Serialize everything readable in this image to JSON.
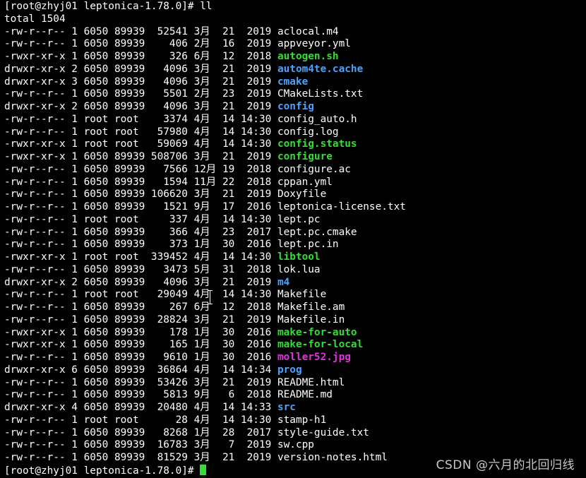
{
  "terminal": {
    "command_line": "[root@zhyj01 leptonica-1.78.0]# ll",
    "total_line": "total 1504",
    "entries": [
      {
        "meta": "-rw-r--r-- 1 6050 89939  52541 3月  21  2019 ",
        "name": "aclocal.m4",
        "type": "plain"
      },
      {
        "meta": "-rw-r--r-- 1 6050 89939    406 2月  16  2019 ",
        "name": "appveyor.yml",
        "type": "plain"
      },
      {
        "meta": "-rwxr-xr-x 1 6050 89939    326 6月  12  2018 ",
        "name": "autogen.sh",
        "type": "exec"
      },
      {
        "meta": "drwxr-xr-x 2 6050 89939   4096 3月  21  2019 ",
        "name": "autom4te.cache",
        "type": "dir"
      },
      {
        "meta": "drwxr-xr-x 3 6050 89939   4096 3月  21  2019 ",
        "name": "cmake",
        "type": "dir"
      },
      {
        "meta": "-rw-r--r-- 1 6050 89939   5501 2月  23  2019 ",
        "name": "CMakeLists.txt",
        "type": "plain"
      },
      {
        "meta": "drwxr-xr-x 2 6050 89939   4096 3月  21  2019 ",
        "name": "config",
        "type": "dir"
      },
      {
        "meta": "-rw-r--r-- 1 root root    3374 4月  14 14:30 ",
        "name": "config_auto.h",
        "type": "plain"
      },
      {
        "meta": "-rw-r--r-- 1 root root   57980 4月  14 14:30 ",
        "name": "config.log",
        "type": "plain"
      },
      {
        "meta": "-rwxr-xr-x 1 root root   59069 4月  14 14:30 ",
        "name": "config.status",
        "type": "exec"
      },
      {
        "meta": "-rwxr-xr-x 1 6050 89939 508706 3月  21  2019 ",
        "name": "configure",
        "type": "exec"
      },
      {
        "meta": "-rw-r--r-- 1 6050 89939   7566 12月 19  2018 ",
        "name": "configure.ac",
        "type": "plain"
      },
      {
        "meta": "-rw-r--r-- 1 6050 89939   1594 11月 22  2018 ",
        "name": "cppan.yml",
        "type": "plain"
      },
      {
        "meta": "-rw-r--r-- 1 6050 89939 106620 3月  21  2019 ",
        "name": "Doxyfile",
        "type": "plain"
      },
      {
        "meta": "-rw-r--r-- 1 6050 89939   1521 9月  17  2016 ",
        "name": "leptonica-license.txt",
        "type": "plain"
      },
      {
        "meta": "-rw-r--r-- 1 root root     337 4月  14 14:30 ",
        "name": "lept.pc",
        "type": "plain"
      },
      {
        "meta": "-rw-r--r-- 1 6050 89939    366 4月  23  2017 ",
        "name": "lept.pc.cmake",
        "type": "plain"
      },
      {
        "meta": "-rw-r--r-- 1 6050 89939    373 1月  30  2016 ",
        "name": "lept.pc.in",
        "type": "plain"
      },
      {
        "meta": "-rwxr-xr-x 1 root root  339452 4月  14 14:30 ",
        "name": "libtool",
        "type": "exec"
      },
      {
        "meta": "-rw-r--r-- 1 6050 89939   3473 5月  31  2018 ",
        "name": "lok.lua",
        "type": "plain"
      },
      {
        "meta": "drwxr-xr-x 2 6050 89939   4096 3月  21  2019 ",
        "name": "m4",
        "type": "dir"
      },
      {
        "meta": "-rw-r--r-- 1 root root   29049 4月  14 14:30 ",
        "name": "Makefile",
        "type": "plain"
      },
      {
        "meta": "-rw-r--r-- 1 6050 89939    267 6月  12  2018 ",
        "name": "Makefile.am",
        "type": "plain"
      },
      {
        "meta": "-rw-r--r-- 1 6050 89939  28824 3月  21  2019 ",
        "name": "Makefile.in",
        "type": "plain"
      },
      {
        "meta": "-rwxr-xr-x 1 6050 89939    178 1月  30  2016 ",
        "name": "make-for-auto",
        "type": "exec"
      },
      {
        "meta": "-rwxr-xr-x 1 6050 89939    165 1月  30  2016 ",
        "name": "make-for-local",
        "type": "exec"
      },
      {
        "meta": "-rw-r--r-- 1 6050 89939   9610 1月  30  2016 ",
        "name": "moller52.jpg",
        "type": "image"
      },
      {
        "meta": "drwxr-xr-x 6 6050 89939  36864 4月  14 14:34 ",
        "name": "prog",
        "type": "dir"
      },
      {
        "meta": "-rw-r--r-- 1 6050 89939  53426 3月  21  2019 ",
        "name": "README.html",
        "type": "plain"
      },
      {
        "meta": "-rw-r--r-- 1 6050 89939   5813 9月   6  2018 ",
        "name": "README.md",
        "type": "plain"
      },
      {
        "meta": "drwxr-xr-x 4 6050 89939  20480 4月  14 14:33 ",
        "name": "src",
        "type": "dir"
      },
      {
        "meta": "-rw-r--r-- 1 root root      28 4月  14 14:30 ",
        "name": "stamp-h1",
        "type": "plain"
      },
      {
        "meta": "-rw-r--r-- 1 6050 89939   8268 1月  28  2017 ",
        "name": "style-guide.txt",
        "type": "plain"
      },
      {
        "meta": "-rw-r--r-- 1 6050 89939  16783 3月   7  2019 ",
        "name": "sw.cpp",
        "type": "plain"
      },
      {
        "meta": "-rw-r--r-- 1 6050 89939  81529 3月  21  2019 ",
        "name": "version-notes.html",
        "type": "plain"
      }
    ],
    "prompt_line": "[root@zhyj01 leptonica-1.78.0]# "
  },
  "watermark": "CSDN @六月的北回归线",
  "colors": {
    "background": "#000000",
    "text": "#ffffff",
    "directory": "#4aa3ff",
    "executable": "#33dd33",
    "image": "#e033e0",
    "cursor": "#33dd33"
  },
  "icons": {
    "mouse_pointer": "text-cursor-ibeam-icon"
  }
}
